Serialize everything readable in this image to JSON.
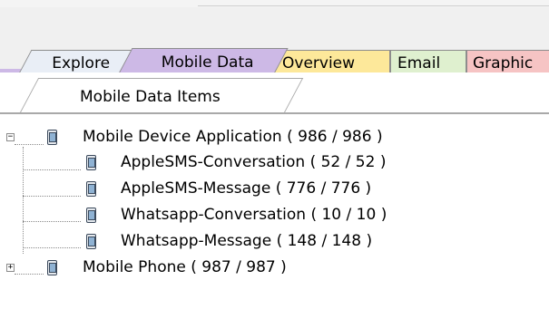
{
  "tabs": [
    {
      "label": "Explore"
    },
    {
      "label": "Mobile Data"
    },
    {
      "label": "Overview"
    },
    {
      "label": "Email"
    },
    {
      "label": "Graphic"
    }
  ],
  "active_tab": "Mobile Data",
  "subtab": {
    "label": "Mobile Data Items"
  },
  "tree": {
    "nodes": [
      {
        "label": "Mobile Device Application ( 986 / 986 )",
        "expanded": true,
        "icon": "mobile-phone-icon"
      },
      {
        "label": "AppleSMS-Conversation ( 52 / 52 )",
        "icon": "mobile-phone-icon"
      },
      {
        "label": "AppleSMS-Message ( 776 / 776 )",
        "icon": "mobile-phone-icon"
      },
      {
        "label": "Whatsapp-Conversation ( 10 / 10 )",
        "icon": "mobile-phone-icon"
      },
      {
        "label": "Whatsapp-Message ( 148 / 148 )",
        "icon": "mobile-phone-icon"
      },
      {
        "label": "Mobile Phone ( 987 / 987 )",
        "expanded": false,
        "icon": "mobile-phone-icon"
      }
    ],
    "expander_symbols": {
      "expanded": "−",
      "collapsed": "+"
    }
  },
  "colors": {
    "explore_tab": "#e9eef6",
    "mobile_data_tab": "#cdb9e6",
    "overview_tab": "#fde89a",
    "email_tab": "#dff0cf",
    "graphic_tab": "#f6c4c4"
  }
}
